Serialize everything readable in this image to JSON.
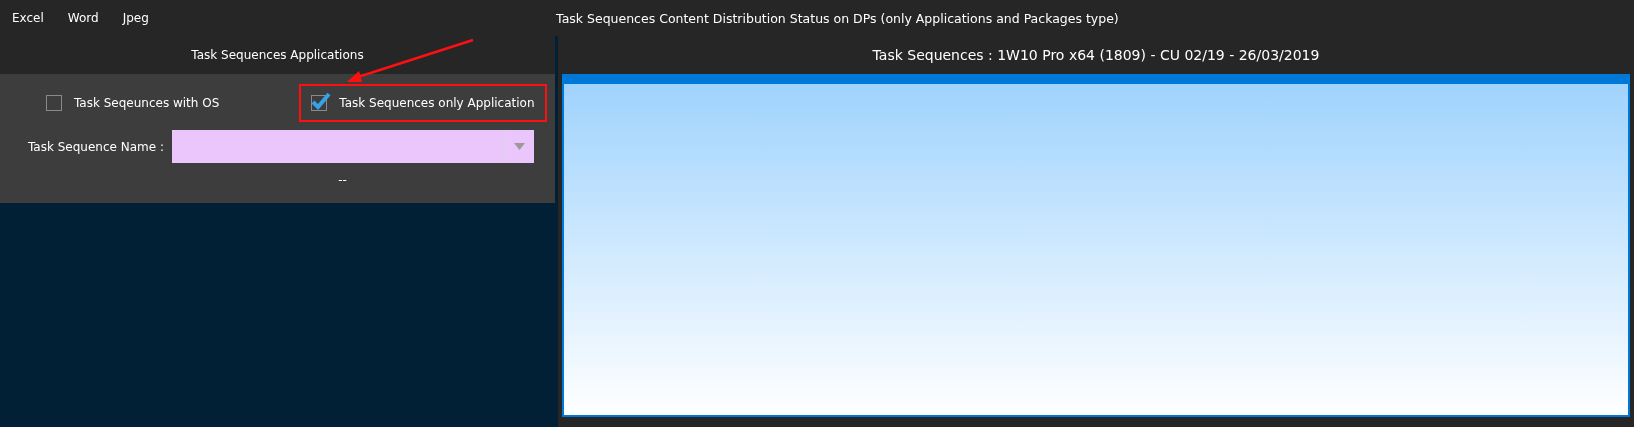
{
  "menu": [
    "Excel",
    "Word",
    "Jpeg"
  ],
  "window": {
    "title": "Task Sequences Content Distribution Status on DPs (only Applications and Packages type)"
  },
  "left_panel": {
    "title": "Task Sequences Applications",
    "options": [
      {
        "label": "Task Seqeunces with OS",
        "checked": false,
        "highlighted": false
      },
      {
        "label": "Task Sequences only Application",
        "checked": true,
        "highlighted": true
      }
    ],
    "name_field": {
      "label": "Task Sequence Name :"
    },
    "status": "--"
  },
  "right_panel": {
    "title": "Task Sequences : 1W10 Pro x64 (1809) - CU 02/19 - 26/03/2019"
  }
}
